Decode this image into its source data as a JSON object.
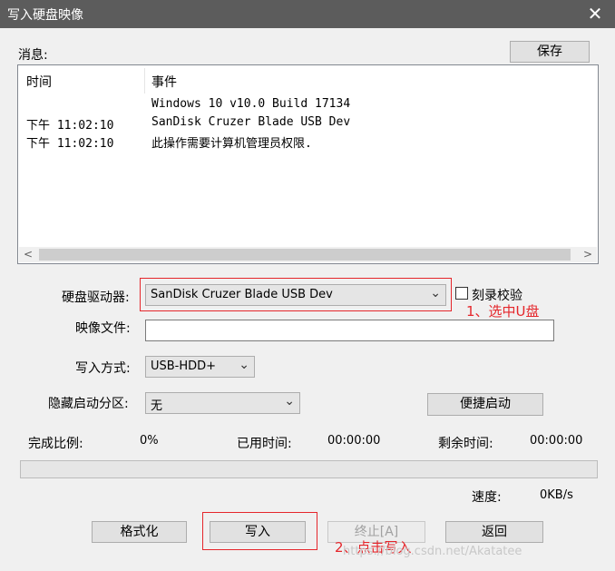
{
  "window": {
    "title": "写入硬盘映像",
    "close_glyph": "✕"
  },
  "messages": {
    "label": "消息:",
    "save_button": "保存",
    "col_time": "时间",
    "col_event": "事件",
    "rows": [
      {
        "time": "",
        "event": "Windows 10 v10.0 Build 17134"
      },
      {
        "time": "下午 11:02:10",
        "event": "SanDisk Cruzer Blade USB Dev"
      },
      {
        "time": "下午 11:02:10",
        "event": "此操作需要计算机管理员权限."
      }
    ],
    "scroll_left": "<",
    "scroll_right": ">"
  },
  "form": {
    "drive_label": "硬盘驱动器:",
    "drive_value": "SanDisk Cruzer Blade USB Dev",
    "verify_label": "刻录校验",
    "image_label": "映像文件:",
    "image_value": "",
    "write_mode_label": "写入方式:",
    "write_mode_value": "USB-HDD+",
    "hidden_partition_label": "隐藏启动分区:",
    "hidden_partition_value": "无",
    "quick_boot_button": "便捷启动"
  },
  "status": {
    "completion_label": "完成比例:",
    "completion_value": "0%",
    "elapsed_label": "已用时间:",
    "elapsed_value": "00:00:00",
    "remaining_label": "剩余时间:",
    "remaining_value": "00:00:00",
    "speed_label": "速度:",
    "speed_value": "0KB/s",
    "progress": 0
  },
  "buttons": {
    "format": "格式化",
    "write": "写入",
    "abort": "终止[A]",
    "back": "返回"
  },
  "annotations": {
    "step1": "1、选中U盘",
    "step2": "2、点击写入",
    "color": "#e5262b"
  },
  "watermark": "https://blog.csdn.net/Akatatee"
}
